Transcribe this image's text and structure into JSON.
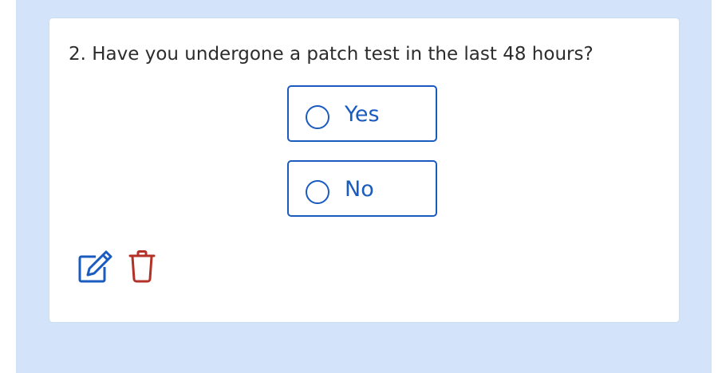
{
  "question": {
    "text": "2. Have you undergone a patch test in the last 48 hours?"
  },
  "options": [
    {
      "label": "Yes",
      "selected": false
    },
    {
      "label": "No",
      "selected": false
    }
  ],
  "actions": {
    "edit_icon": "pencil-square-icon",
    "delete_icon": "trash-icon"
  },
  "colors": {
    "background": "#d3e4fa",
    "accent": "#1a5bbf",
    "danger": "#b33127",
    "text": "#2c2c2c"
  }
}
